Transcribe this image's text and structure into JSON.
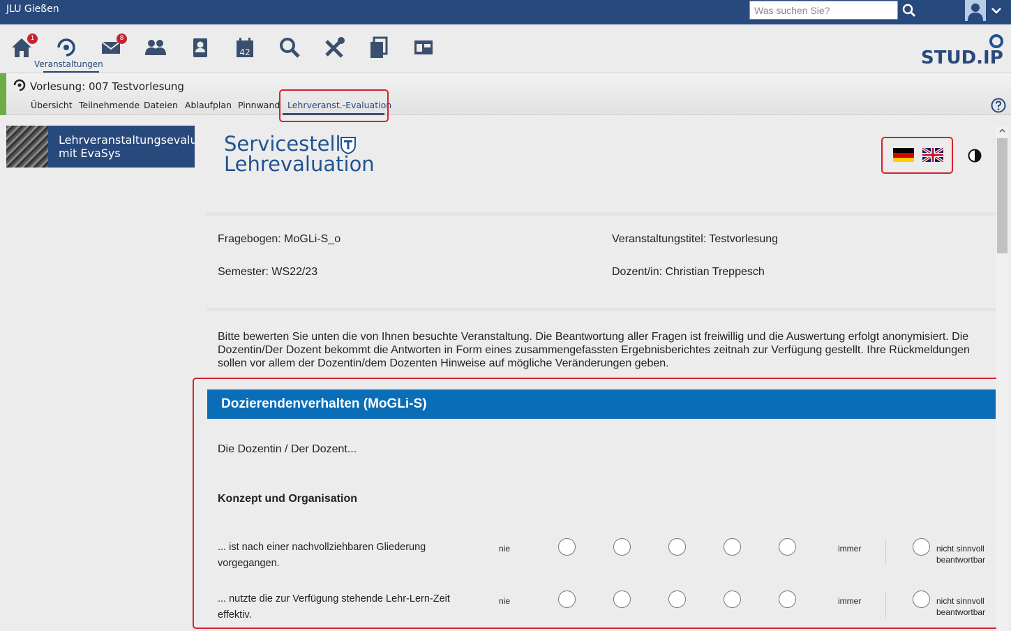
{
  "topbar": {
    "institution": "JLU Gießen",
    "search_placeholder": "Was suchen Sie?"
  },
  "nav": {
    "home_badge": "1",
    "messages_badge": "8",
    "active_label": "Veranstaltungen",
    "calendar_day": "42"
  },
  "logo": {
    "text": "STUD.IP"
  },
  "course": {
    "title": "Vorlesung: 007 Testvorlesung",
    "tabs": [
      "Übersicht",
      "Teilnehmende",
      "Dateien",
      "Ablaufplan",
      "Pinnwand",
      "Lehrveranst.-Evaluation"
    ]
  },
  "sidebar": {
    "widget_title": "Lehrveranstaltungsevaluation mit EvaSys"
  },
  "brand": {
    "line1": "Servicestelle",
    "line2": "Lehrevaluation"
  },
  "meta": {
    "fragebogen": "Fragebogen: MoGLi-S_o",
    "semester": "Semester: WS22/23",
    "titel": "Veranstaltungstitel: Testvorlesung",
    "dozent": "Dozent/in: Christian Treppesch"
  },
  "intro": "Bitte bewerten Sie unten die von Ihnen besuchte Veranstaltung. Die Beantwortung aller Fragen ist freiwillig und die Auswertung erfolgt anonymisiert. Die Dozentin/Der Dozent bekommt die Antworten in Form eines zusammengefassten Ergebnisberichtes zeitnah zur Verfügung gestellt. Ihre Rückmeldungen sollen vor allem der Dozentin/dem Dozenten Hinweise auf mögliche Veränderungen geben.",
  "section": {
    "title": "Dozierendenverhalten (MoGLi-S)",
    "lead": "Die Dozentin / Der Dozent...",
    "subsection": "Konzept und Organisation"
  },
  "questions": [
    {
      "text": "... ist nach einer nachvollziehbaren Gliederung vorgegangen.",
      "low": "nie",
      "high": "immer",
      "na_line1": "nicht sinnvoll",
      "na_line2": "beantwortbar"
    },
    {
      "text": "... nutzte die zur Verfügung stehende Lehr-Lern-Zeit effektiv.",
      "low": "nie",
      "high": "immer",
      "na_line1": "nicht sinnvoll",
      "na_line2": "beantwortbar"
    }
  ],
  "colors": {
    "topbar": "#28497c",
    "section_header": "#0a6db7",
    "highlight": "#d6202e",
    "course_accent": "#6cad45"
  }
}
